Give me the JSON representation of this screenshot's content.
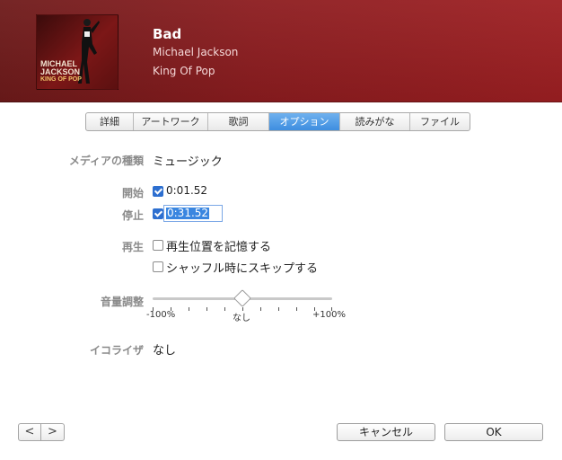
{
  "header": {
    "title": "Bad",
    "artist": "Michael Jackson",
    "album": "King Of Pop",
    "artwork": {
      "line1": "MICHAEL",
      "line2": "JACKSON",
      "line3": "KING OF POP"
    }
  },
  "tabs": [
    {
      "label": "詳細"
    },
    {
      "label": "アートワーク"
    },
    {
      "label": "歌詞"
    },
    {
      "label": "オプション",
      "active": true
    },
    {
      "label": "読みがな"
    },
    {
      "label": "ファイル"
    }
  ],
  "options": {
    "media_kind_label": "メディアの種類",
    "media_kind_value": "ミュージック",
    "start_label": "開始",
    "start_value": "0:01.52",
    "stop_label": "停止",
    "stop_value": "0:31.52",
    "playback_label": "再生",
    "remember_position": "再生位置を記憶する",
    "skip_shuffle": "シャッフル時にスキップする",
    "volume_label": "音量調整",
    "volume_min": "-100%",
    "volume_mid": "なし",
    "volume_max": "+100%",
    "eq_label": "イコライザ",
    "eq_value": "なし"
  },
  "buttons": {
    "prev": "<",
    "next": ">",
    "cancel": "キャンセル",
    "ok": "OK"
  },
  "colors": {
    "header": "#8c1c1f",
    "active_tab": "#3e8ee0",
    "checkbox": "#2d6fd0"
  }
}
